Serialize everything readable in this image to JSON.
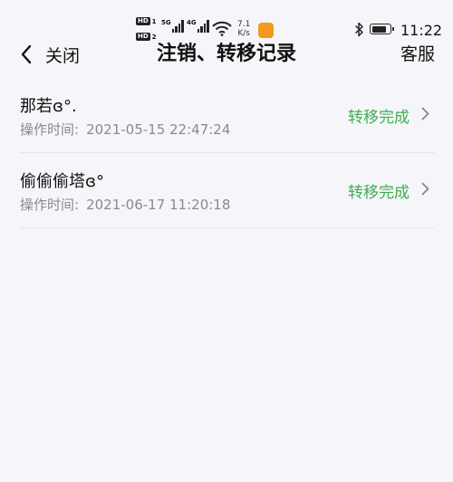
{
  "status_bar": {
    "sim1": {
      "hd": "HD",
      "num": "1",
      "network": "5G"
    },
    "sim2": {
      "hd": "HD",
      "num": "2",
      "network": "4G"
    },
    "speed_value": "7.1",
    "speed_unit": "K/s",
    "time": "11:22",
    "battery_level": 0.85,
    "app_badge_color": "#f39a1e"
  },
  "nav": {
    "back_label": "关闭",
    "title": "注销、转移记录",
    "service_label": "客服"
  },
  "records": [
    {
      "name": "那若ɞ°.",
      "time_label": "操作时间:",
      "time_value": "2021-05-15 22:47:24",
      "status": "转移完成"
    },
    {
      "name": "偷偷偷塔ɞ°",
      "time_label": "操作时间:",
      "time_value": "2021-06-17 11:20:18",
      "status": "转移完成"
    }
  ],
  "colors": {
    "background": "#f6f6fa",
    "status_green": "#3fae52",
    "secondary_text": "#8a8a8e"
  }
}
